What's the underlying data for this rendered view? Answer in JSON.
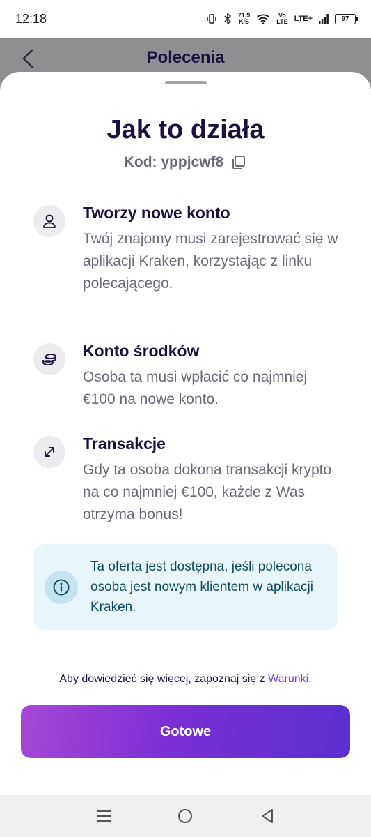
{
  "status": {
    "time": "12:18",
    "speed_value": "71,9",
    "speed_unit": "K/S",
    "volte_top": "Vo",
    "volte_bottom": "LTE",
    "network": "LTE+",
    "battery": "97"
  },
  "header": {
    "title": "Polecenia"
  },
  "sheet": {
    "title": "Jak to działa",
    "code_label": "Kod: yppjcwf8",
    "steps": [
      {
        "heading": "Tworzy nowe konto",
        "body": "Twój znajomy musi zarejestrować się w aplikacji Kraken, korzystając z linku polecającego.",
        "icon": "person-icon"
      },
      {
        "heading": "Konto środków",
        "body": "Osoba ta musi wpłacić co najmniej €100 na nowe konto.",
        "icon": "coins-icon"
      },
      {
        "heading": "Transakcje",
        "body": "Gdy ta osoba dokona transakcji krypto na co najmniej €100, każde z Was otrzyma bonus!",
        "icon": "arrows-icon"
      }
    ],
    "info_text": "Ta oferta jest dostępna, jeśli polecona osoba jest nowym klientem w aplikacji Kraken.",
    "terms_prefix": "Aby dowiedzieć się więcej, zapoznaj się z ",
    "terms_link": "Warunki",
    "terms_suffix": ".",
    "done_button": "Gotowe"
  },
  "colors": {
    "primary_text": "#1b1040",
    "secondary_text": "#6b6b78",
    "accent": "#7a3fe0",
    "info_bg": "#e8f5fb"
  }
}
